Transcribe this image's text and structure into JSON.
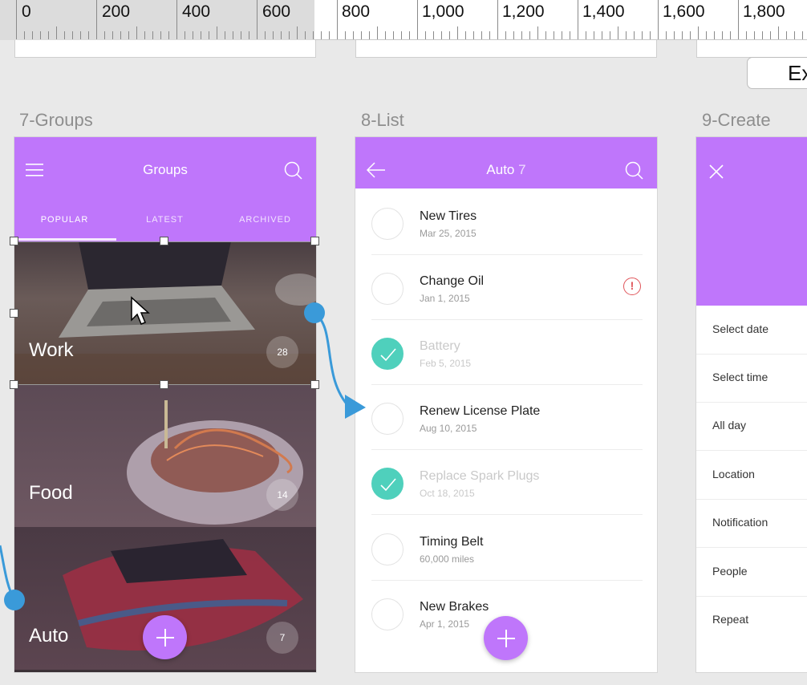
{
  "ruler": {
    "labels": [
      "0",
      "200",
      "400",
      "600",
      "800",
      "1,000",
      "1,200",
      "1,400",
      "1,600",
      "1,800"
    ]
  },
  "toolbar": {
    "export_label": "Ex"
  },
  "artboards": {
    "groups": {
      "title": "7-Groups",
      "header": "Groups",
      "tabs": [
        "POPULAR",
        "LATEST",
        "ARCHIVED"
      ],
      "rows": [
        {
          "label": "Work",
          "count": "28"
        },
        {
          "label": "Food",
          "count": "14"
        },
        {
          "label": "Auto",
          "count": "7"
        }
      ]
    },
    "list": {
      "title": "8-List",
      "header": "Auto",
      "header_count": "7",
      "items": [
        {
          "name": "New Tires",
          "date": "Mar 25, 2015",
          "done": false,
          "alert": false
        },
        {
          "name": "Change Oil",
          "date": "Jan 1, 2015",
          "done": false,
          "alert": true
        },
        {
          "name": "Battery",
          "date": "Feb 5, 2015",
          "done": true,
          "alert": false
        },
        {
          "name": "Renew License Plate",
          "date": "Aug 10, 2015",
          "done": false,
          "alert": false
        },
        {
          "name": "Replace Spark Plugs",
          "date": "Oct 18, 2015",
          "done": true,
          "alert": false
        },
        {
          "name": "Timing Belt",
          "date": "60,000 miles",
          "done": false,
          "alert": false
        },
        {
          "name": "New Brakes",
          "date": "Apr 1, 2015",
          "done": false,
          "alert": false
        }
      ]
    },
    "create": {
      "title": "9-Create",
      "fields": [
        "Select date",
        "Select time",
        "All day",
        "Location",
        "Notification",
        "People",
        "Repeat"
      ]
    }
  },
  "colors": {
    "accent": "#bf76fb",
    "done": "#4fd0bc",
    "link": "#3a9ad9",
    "alert": "#e0555a"
  }
}
